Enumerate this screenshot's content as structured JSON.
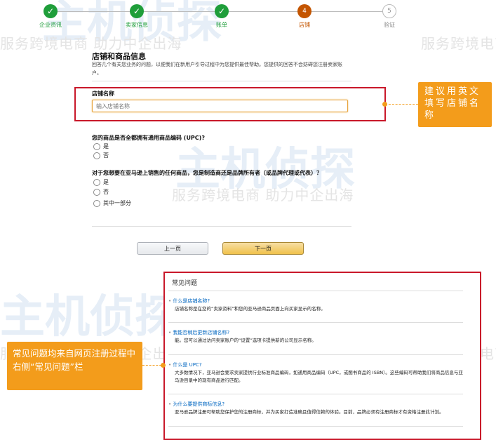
{
  "watermark": {
    "slogan": "服务跨境电商 助力中企出海",
    "brand": "主机侦探"
  },
  "stepper": {
    "steps": [
      {
        "label": "企业资讯",
        "state": "done",
        "num": ""
      },
      {
        "label": "卖家信息",
        "state": "done",
        "num": ""
      },
      {
        "label": "账单",
        "state": "done",
        "num": ""
      },
      {
        "label": "店铺",
        "state": "current",
        "num": "4"
      },
      {
        "label": "验证",
        "state": "todo",
        "num": "5"
      }
    ]
  },
  "form": {
    "title": "店铺和商品信息",
    "description": "回答几个有关您业务的问题，以便我们在新用户引导过程中为您提供最佳帮助。您提供的回答不会妨碍您注册卖家账户。",
    "store_name_label": "店铺名称",
    "store_name_placeholder": "输入店铺名称",
    "q1": "您的商品是否全都拥有通用商品编码 (UPC)?",
    "q1_options": [
      "是",
      "否"
    ],
    "q2": "对于您想要在亚马逊上销售的任何商品，您是制造商还是品牌所有者（或品牌代理或代表）？",
    "q2_options": [
      "是",
      "否",
      "其中一部分"
    ],
    "prev_label": "上一页",
    "next_label": "下一页"
  },
  "callouts": {
    "store_name": "建议用英文填写店铺名称",
    "faq": "常见问题均来自网页注册过程中右侧“常见问题”栏"
  },
  "faq": {
    "title": "常见问题",
    "items": [
      {
        "q": "什么是店铺名称?",
        "a": "店铺名称是在您的“卖家资料”和您的亚马逊商品页面上向买家显示的名称。"
      },
      {
        "q": "我能否稍后更新店铺名称?",
        "a": "能。您可以通过访问卖家账户的“设置”选项卡提供新的公司显示名称。"
      },
      {
        "q": "什么是 UPC?",
        "a": "大多数情况下，亚马逊会要求卖家提供行业标准商品编码，如通用商品编码（UPC，或图书商品的 ISBN）。这些编码可帮助我们将商品信息与亚马逊目录中的现有商品进行匹配。"
      },
      {
        "q": "为什么要提供商标信息?",
        "a": "亚马逊品牌注册可帮助您保护您的注册商标，并为买家打造准确且值得信赖的体验。目前，品牌必须有注册商标才有资格注册此计划。"
      }
    ]
  },
  "colors": {
    "done": "#1f9e3a",
    "current": "#c45500",
    "callout": "#f39c1b",
    "highlight": "#c9182a",
    "link": "#0066c0"
  }
}
